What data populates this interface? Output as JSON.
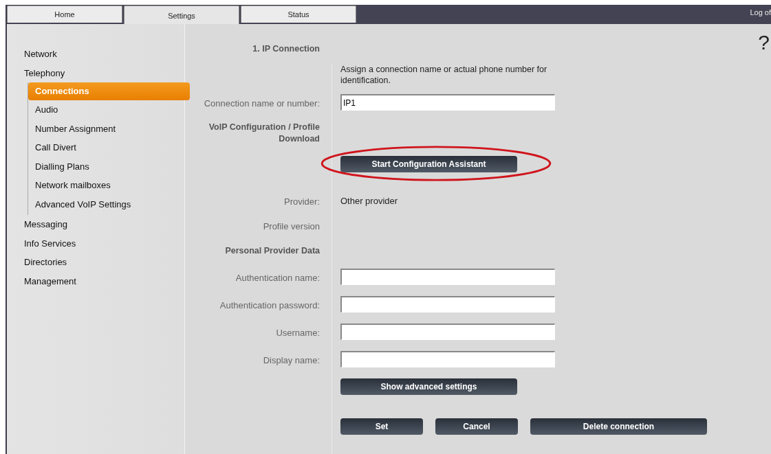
{
  "tabs": [
    {
      "label": "Home",
      "selected": false
    },
    {
      "label": "Settings",
      "selected": true
    },
    {
      "label": "Status",
      "selected": false
    }
  ],
  "logoff": "Log of",
  "help": "?",
  "sidebar": {
    "items": [
      {
        "label": "Network",
        "selected": false
      },
      {
        "label": "Telephony",
        "selected": false,
        "expanded": true,
        "children": [
          {
            "label": "Connections",
            "selected": true
          },
          {
            "label": "Audio",
            "selected": false
          },
          {
            "label": "Number Assignment",
            "selected": false
          },
          {
            "label": "Call Divert",
            "selected": false
          },
          {
            "label": "Dialling Plans",
            "selected": false
          },
          {
            "label": "Network mailboxes",
            "selected": false
          },
          {
            "label": "Advanced VoIP Settings",
            "selected": false
          }
        ]
      },
      {
        "label": "Messaging",
        "selected": false
      },
      {
        "label": "Info Services",
        "selected": false
      },
      {
        "label": "Directories",
        "selected": false
      },
      {
        "label": "Management",
        "selected": false
      }
    ]
  },
  "form": {
    "rows": [
      {
        "kind": "heading",
        "label": "1. IP Connection"
      },
      {
        "kind": "note",
        "text": "Assign a connection name or actual phone number for identification."
      },
      {
        "kind": "field",
        "label": "Connection name or number:",
        "value": "IP1"
      },
      {
        "kind": "heading",
        "label": "VoIP Configuration / Profile Download"
      },
      {
        "kind": "button",
        "label": "Start Configuration Assistant",
        "circled": true
      },
      {
        "kind": "info",
        "label": "Provider:",
        "text": "Other provider"
      },
      {
        "kind": "info",
        "label": "Profile version"
      },
      {
        "kind": "heading",
        "label": "Personal Provider Data"
      },
      {
        "kind": "field",
        "label": "Authentication name:"
      },
      {
        "kind": "field",
        "label": "Authentication password:"
      },
      {
        "kind": "field",
        "label": "Username:"
      },
      {
        "kind": "field",
        "label": "Display name:"
      },
      {
        "kind": "button",
        "label": "Show advanced settings",
        "circled": false
      }
    ],
    "actions": [
      {
        "label": "Set"
      },
      {
        "label": "Cancel"
      },
      {
        "label": "Delete connection"
      }
    ]
  }
}
